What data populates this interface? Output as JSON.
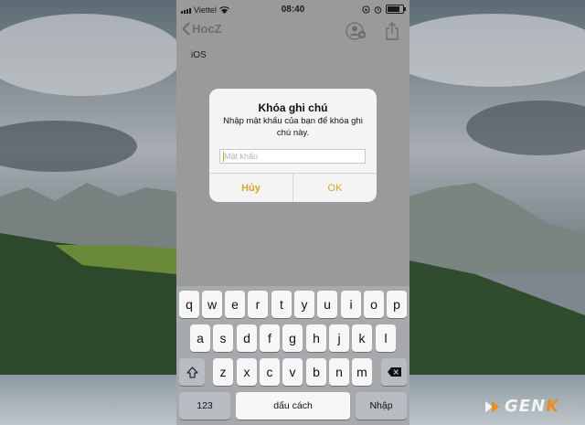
{
  "status_bar": {
    "carrier": "Viettel",
    "time": "08:40"
  },
  "nav": {
    "back_label": "HocZ"
  },
  "note": {
    "text": "iOS"
  },
  "dialog": {
    "title": "Khóa ghi chú",
    "message": "Nhập mật khẩu của bạn để khóa ghi chú này.",
    "password_placeholder": "Mật khẩu",
    "cancel_label": "Hủy",
    "ok_label": "OK"
  },
  "keyboard": {
    "row1": [
      "q",
      "w",
      "e",
      "r",
      "t",
      "y",
      "u",
      "i",
      "o",
      "p"
    ],
    "row2": [
      "a",
      "s",
      "d",
      "f",
      "g",
      "h",
      "j",
      "k",
      "l"
    ],
    "row3": [
      "z",
      "x",
      "c",
      "v",
      "b",
      "n",
      "m"
    ],
    "numbers_label": "123",
    "space_label": "dấu cách",
    "return_label": "Nhập"
  },
  "watermark": {
    "logo_text": "GEN",
    "logo_accent": "K"
  },
  "colors": {
    "accent": "#d2a82a",
    "logo_orange": "#f28a1d"
  }
}
